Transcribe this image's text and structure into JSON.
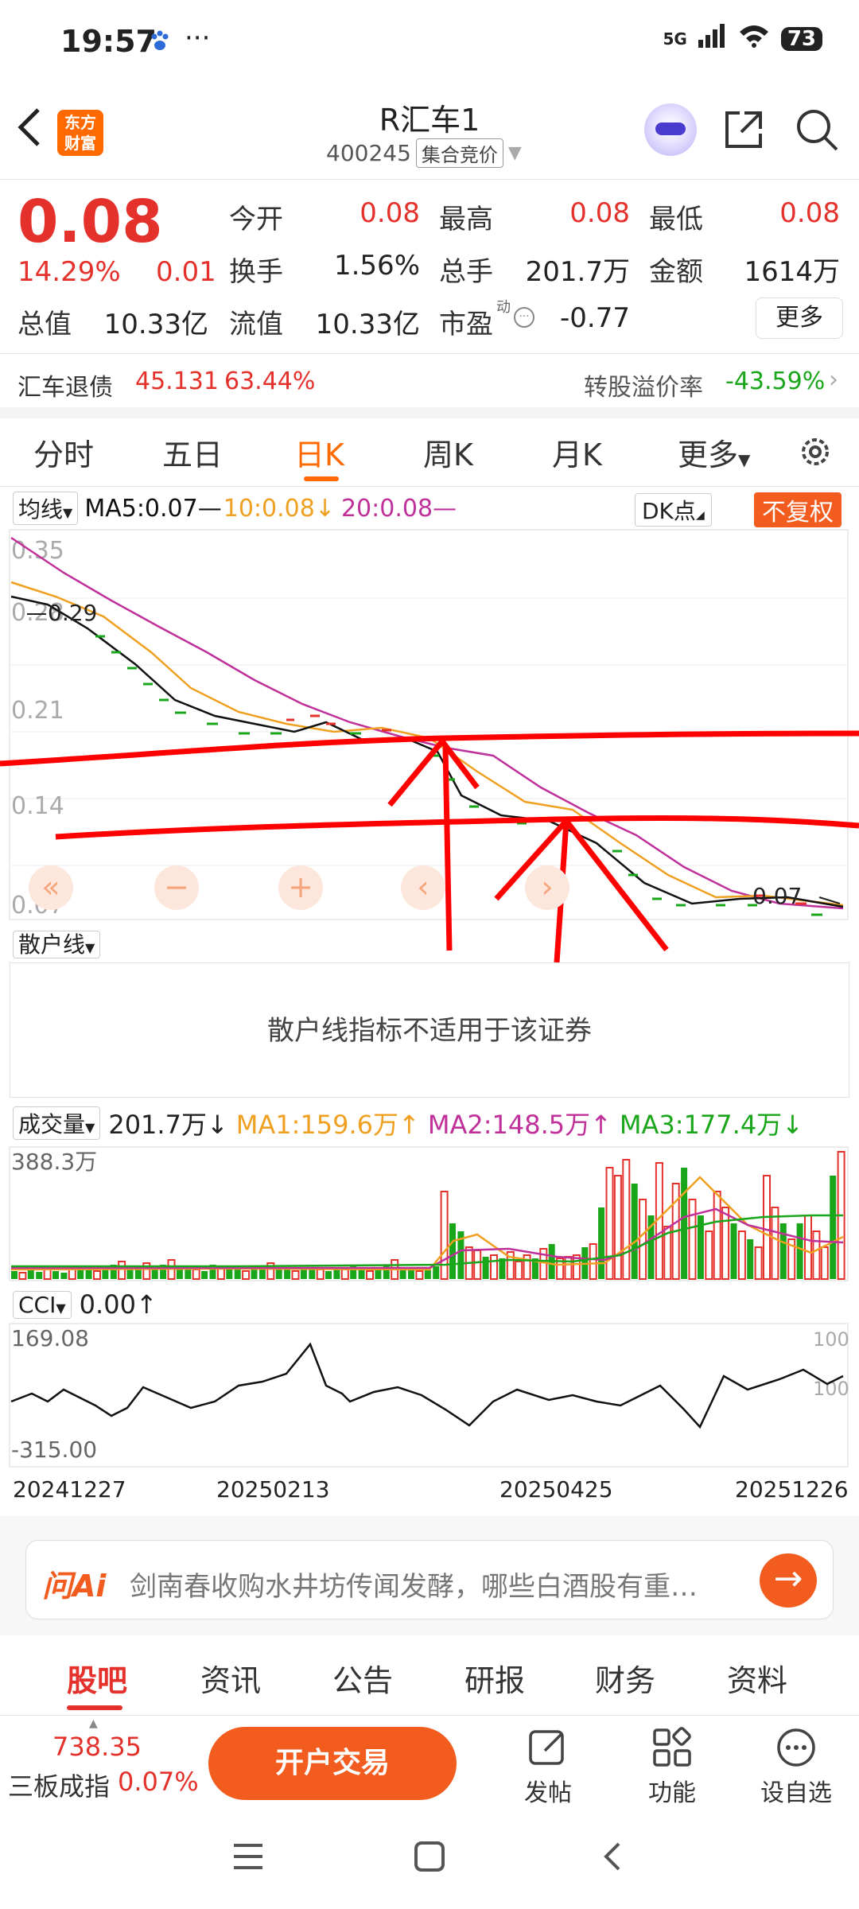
{
  "status": {
    "time": "19:57",
    "dots": "···",
    "network": "5G",
    "battery": "73"
  },
  "header": {
    "title": "R汇车1",
    "code": "400245",
    "auction": "集合竞价",
    "logo": "东方财富"
  },
  "quote": {
    "price": "0.08",
    "pct": "14.29%",
    "change": "0.01",
    "open_label": "今开",
    "open": "0.08",
    "high_label": "最高",
    "high": "0.08",
    "low_label": "最低",
    "low": "0.08",
    "turnover_label": "换手",
    "turnover": "1.56%",
    "volume_label": "总手",
    "volume": "201.7万",
    "amount_label": "金额",
    "amount": "1614万",
    "mcap_label": "总值",
    "mcap": "10.33亿",
    "float_label": "流值",
    "float": "10.33亿",
    "pe_label": "市盈",
    "pe_sup": "动",
    "pe": "-0.77",
    "more": "更多"
  },
  "bond": {
    "name": "汇车退债",
    "price": "45.131",
    "pct": "63.44%",
    "premium_label": "转股溢价率",
    "premium": "-43.59%"
  },
  "period_tabs": [
    "分时",
    "五日",
    "日K",
    "周K",
    "月K",
    "更多"
  ],
  "period_active": 2,
  "ma": {
    "label": "均线",
    "ma5": "MA5:0.07—",
    "ma10": "10:0.08↓",
    "ma20": "20:0.08—",
    "dk": "DK点",
    "fq": "不复权",
    "y_labels": [
      "0.35",
      "0.28",
      "0.21",
      "0.14",
      "0.07"
    ],
    "high_marker": "0.29",
    "low_marker": "0.07",
    "colors": {
      "ma5": "#111111",
      "ma10": "#f0a020",
      "ma20": "#c0309a"
    }
  },
  "controls": [
    "«",
    "−",
    "+",
    "‹",
    "›"
  ],
  "retail": {
    "label": "散户线",
    "message": "散户线指标不适用于该证券"
  },
  "volume": {
    "label": "成交量",
    "value": "201.7万↓",
    "ma1": "MA1:159.6万↑",
    "ma2": "MA2:148.5万↑",
    "ma3": "MA3:177.4万↓",
    "y_top": "388.3万"
  },
  "cci": {
    "label": "CCI",
    "value": "0.00↑",
    "y_top": "169.08",
    "y_bottom": "-315.00",
    "r_top": "100",
    "r_bottom": "100"
  },
  "dates": [
    "20241227",
    "20250213",
    "20250425",
    "20251226"
  ],
  "ai": {
    "logo": "问Ai",
    "text": "剑南春收购水井坊传闻发酵，哪些白酒股有重…"
  },
  "content_tabs": [
    "股吧",
    "资讯",
    "公告",
    "研报",
    "财务",
    "资料"
  ],
  "content_active": 0,
  "bottom": {
    "index_value": "738.35",
    "index_name": "三板成指",
    "index_pct": "0.07%",
    "trade": "开户交易",
    "post": "发帖",
    "func": "功能",
    "watch": "设自选"
  }
}
